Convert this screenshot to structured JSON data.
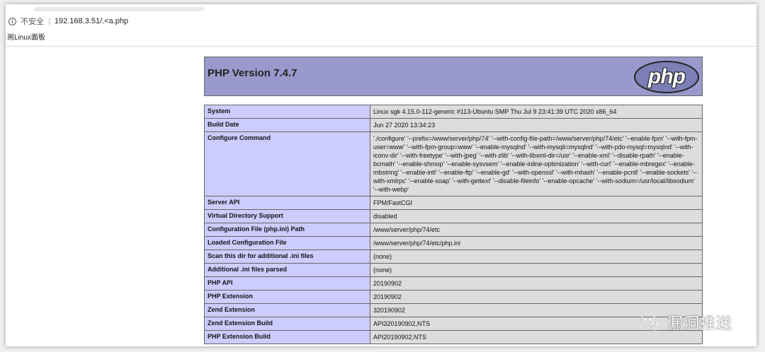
{
  "browser": {
    "security_label": "不安全",
    "separator": "|",
    "url": "192.168.3.51/.<a.php",
    "bookmark": "耑Linux面板"
  },
  "phpinfo": {
    "version_title": "PHP Version 7.4.7",
    "logo_text": "php",
    "rows": [
      {
        "key": "System",
        "value": "Linux sgk 4.15.0-112-generic #113-Ubuntu SMP Thu Jul 9 23:41:39 UTC 2020 x86_64"
      },
      {
        "key": "Build Date",
        "value": "Jun 27 2020 13:34:23"
      },
      {
        "key": "Configure Command",
        "value": "'./configure' '--prefix=/www/server/php/74' '--with-config-file-path=/www/server/php/74/etc' '--enable-fpm' '--with-fpm-user=www' '--with-fpm-group=www' '--enable-mysqlnd' '--with-mysqli=mysqlnd' '--with-pdo-mysql=mysqlnd' '--with-iconv-dir' '--with-freetype' '--with-jpeg' '--with-zlib' '--with-libxml-dir=/usr' '--enable-xml' '--disable-rpath' '--enable-bcmath' '--enable-shmop' '--enable-sysvsem' '--enable-inline-optimization' '--with-curl' '--enable-mbregex' '--enable-mbstring' '--enable-intl' '--enable-ftp' '--enable-gd' '--with-openssl' '--with-mhash' '--enable-pcntl' '--enable-sockets' '--with-xmlrpc' '--enable-soap' '--with-gettext' '--disable-fileinfo' '--enable-opcache' '--with-sodium=/usr/local/libsodium' '--with-webp'"
      },
      {
        "key": "Server API",
        "value": "FPM/FastCGI"
      },
      {
        "key": "Virtual Directory Support",
        "value": "disabled"
      },
      {
        "key": "Configuration File (php.ini) Path",
        "value": "/www/server/php/74/etc"
      },
      {
        "key": "Loaded Configuration File",
        "value": "/www/server/php/74/etc/php.ini"
      },
      {
        "key": "Scan this dir for additional .ini files",
        "value": "(none)"
      },
      {
        "key": "Additional .ini files parsed",
        "value": "(none)"
      },
      {
        "key": "PHP API",
        "value": "20190902"
      },
      {
        "key": "PHP Extension",
        "value": "20190902"
      },
      {
        "key": "Zend Extension",
        "value": "320190902"
      },
      {
        "key": "Zend Extension Build",
        "value": "API320190902,NTS"
      },
      {
        "key": "PHP Extension Build",
        "value": "API20190902,NTS"
      }
    ]
  },
  "watermark": {
    "text": "漏洞推送"
  }
}
